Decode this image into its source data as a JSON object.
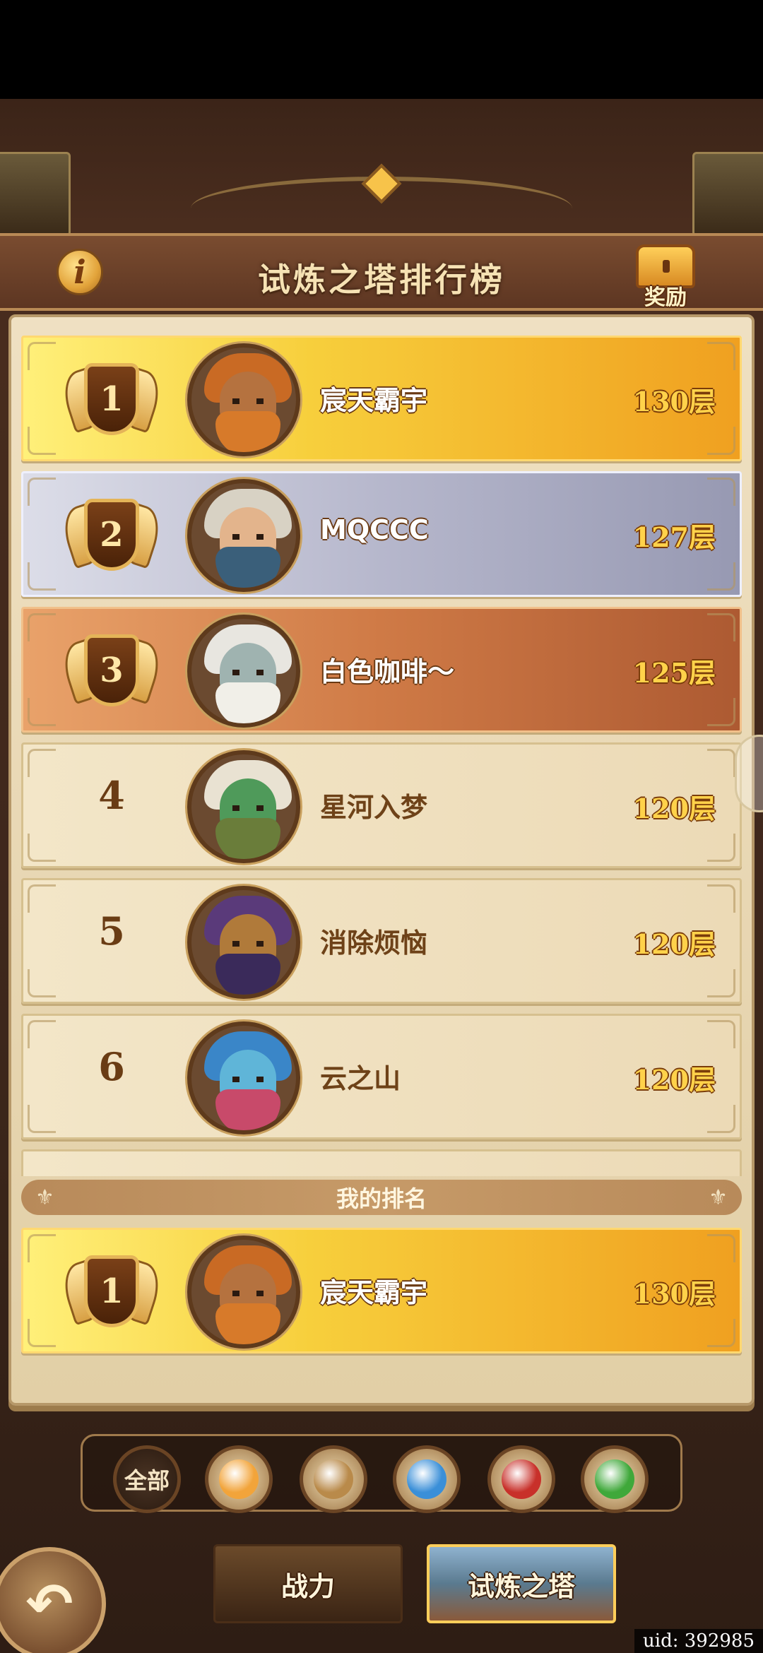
{
  "header": {
    "title": "试炼之塔排行榜",
    "info_icon_glyph": "i",
    "reward_label": "奖励"
  },
  "leaderboard": [
    {
      "rank": "1",
      "name": "宸天霸宇",
      "score": "130层",
      "style": "gold"
    },
    {
      "rank": "2",
      "name": "MQCCC",
      "score": "127层",
      "style": "silver"
    },
    {
      "rank": "3",
      "name": "白色咖啡～",
      "score": "125层",
      "style": "bronze"
    },
    {
      "rank": "4",
      "name": "星河入梦",
      "score": "120层",
      "style": "plain"
    },
    {
      "rank": "5",
      "name": "消除烦恼",
      "score": "120层",
      "style": "plain"
    },
    {
      "rank": "6",
      "name": "云之山",
      "score": "120层",
      "style": "plain"
    }
  ],
  "my_rank": {
    "label": "我的排名",
    "rank": "1",
    "name": "宸天霸宇",
    "score": "130层"
  },
  "filters": [
    {
      "label": "全部",
      "icon": "all-filter-icon"
    },
    {
      "label": "",
      "icon": "light-faction-icon",
      "color": "#f2a43a"
    },
    {
      "label": "",
      "icon": "earth-faction-icon",
      "color": "#b98a4a"
    },
    {
      "label": "",
      "icon": "water-faction-icon",
      "color": "#3a8fd8"
    },
    {
      "label": "",
      "icon": "fire-faction-icon",
      "color": "#c8302a"
    },
    {
      "label": "",
      "icon": "wind-faction-icon",
      "color": "#3fa83a"
    }
  ],
  "tabs": {
    "power": "战力",
    "tower": "试炼之塔"
  },
  "footer": {
    "back_glyph": "↶",
    "uid": "uid: 392985"
  }
}
